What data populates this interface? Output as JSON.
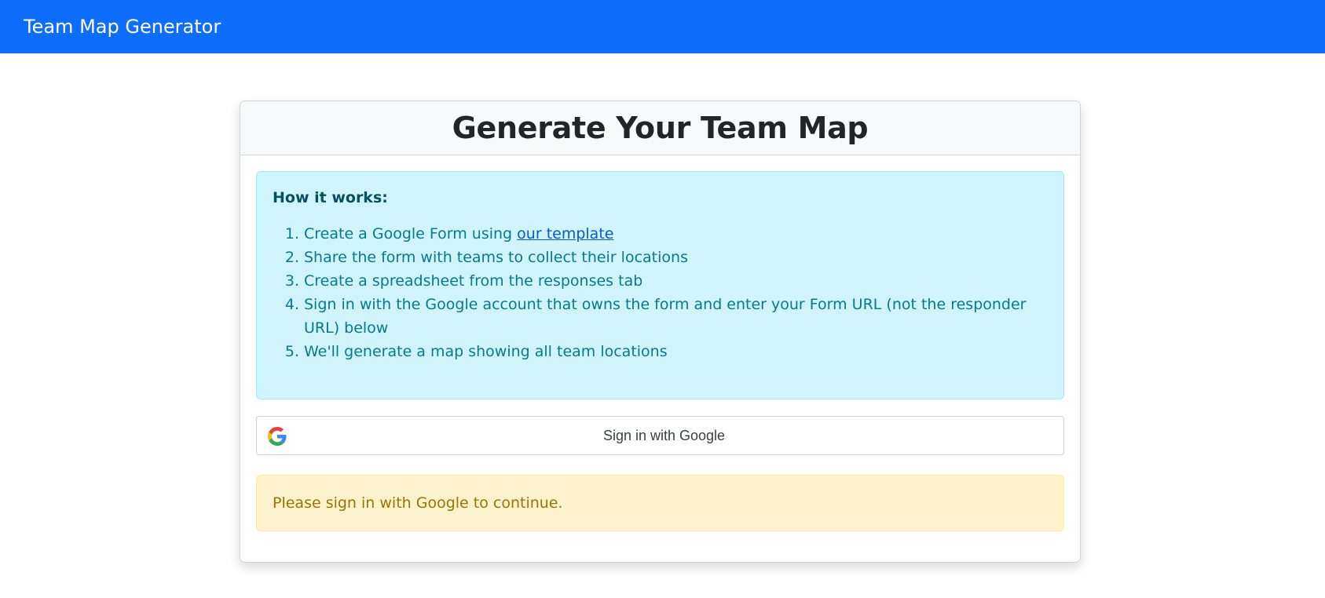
{
  "navbar": {
    "brand": "Team Map Generator",
    "bg_color": "#0d6efd"
  },
  "card": {
    "title": "Generate Your Team Map"
  },
  "how_it_works": {
    "title": "How it works:",
    "steps": [
      {
        "num": "1.",
        "before": "Create a Google Form using ",
        "link": "our template",
        "after": ""
      },
      {
        "num": "2.",
        "before": "Share the form with teams to collect their locations",
        "link": "",
        "after": ""
      },
      {
        "num": "3.",
        "before": "Create a spreadsheet from the responses tab",
        "link": "",
        "after": ""
      },
      {
        "num": "4.",
        "before": "Sign in with the Google account that owns the form and enter your Form URL (not the responder URL) below",
        "link": "",
        "after": ""
      },
      {
        "num": "5.",
        "before": "We'll generate a map showing all team locations",
        "link": "",
        "after": ""
      }
    ]
  },
  "google_button": {
    "label": "Sign in with Google",
    "icon": "google-g-icon"
  },
  "warning": {
    "text": "Please sign in with Google to continue."
  }
}
